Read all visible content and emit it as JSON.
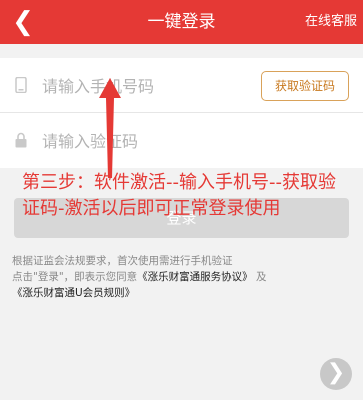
{
  "header": {
    "back_icon": "chevron-left-icon",
    "title": "一键登录",
    "service_label": "在线客服"
  },
  "form": {
    "phone_placeholder": "请输入手机号码",
    "phone_icon": "phone-icon",
    "code_placeholder": "请输入验证码",
    "code_icon": "lock-icon",
    "get_code_label": "获取验证码"
  },
  "login_button_label": "登录",
  "terms": {
    "line1": "根据证监会法规要求，首次使用需进行手机验证",
    "line2_prefix": "点击\"登录\"，即表示您同意",
    "service_agreement": "《涨乐财富通服务协议》",
    "and": "及",
    "membership_rules": "《涨乐财富通U会员规则》"
  },
  "annotation": {
    "text": "第三步：软件激活--输入手机号--获取验证码-激活以后即可正常登录使用",
    "color": "#e53935"
  },
  "next_icon": "chevron-right-icon",
  "colors": {
    "header": "#e53935",
    "code_button_border": "#d9a25a",
    "code_button_text": "#c8791f"
  }
}
